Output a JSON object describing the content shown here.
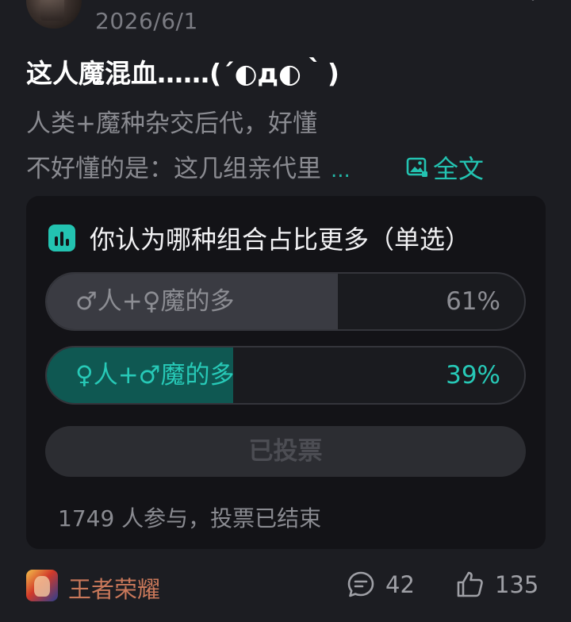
{
  "post": {
    "date": "2026/6/1",
    "title": "这人魔混血……(´◐д◐｀)",
    "body_line1": "人类+魔种杂交后代，好懂",
    "body_line2": "不好懂的是：这几组亲代里",
    "ellipsis": "...",
    "full_text_label": "全文"
  },
  "poll": {
    "question": "你认为哪种组合占比更多（单选）",
    "options": [
      {
        "label": "♂人+♀魔的多",
        "percent": "61%",
        "fraction": 0.61
      },
      {
        "label": "♀人+♂魔的多",
        "percent": "39%",
        "fraction": 0.39
      }
    ],
    "voted_label": "已投票",
    "footer": "1749 人参与，投票已结束"
  },
  "footer": {
    "game_name": "王者荣耀",
    "comments": "42",
    "likes": "135"
  },
  "colors": {
    "accent": "#23c3b1",
    "background": "#1c1d22",
    "card": "#131317",
    "game_name": "#c9785a"
  },
  "icons": [
    "more-icon",
    "image-icon",
    "poll-chart-icon",
    "comment-icon",
    "thumbs-up-icon"
  ]
}
